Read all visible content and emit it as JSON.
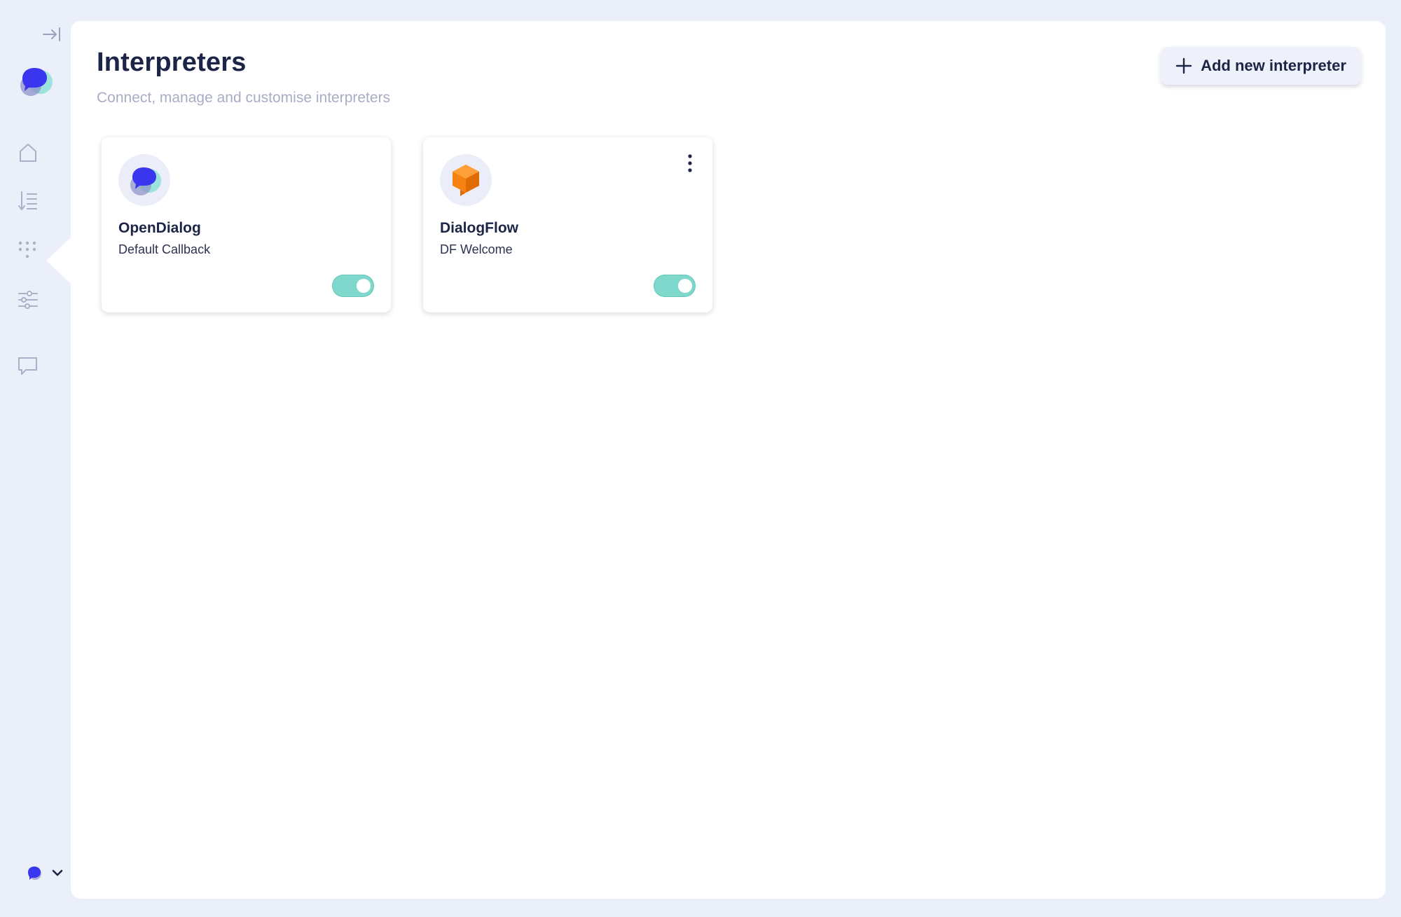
{
  "page": {
    "title": "Interpreters",
    "subtitle": "Connect, manage and customise interpreters"
  },
  "actions": {
    "add_label": "Add new interpreter"
  },
  "interpreters": [
    {
      "name": "OpenDialog",
      "description": "Default Callback",
      "icon": "opendialog-logo-icon",
      "enabled": true,
      "has_menu": false
    },
    {
      "name": "DialogFlow",
      "description": "DF Welcome",
      "icon": "dialogflow-logo-icon",
      "enabled": true,
      "has_menu": true
    }
  ],
  "sidebar": {
    "items": [
      {
        "icon": "home-icon"
      },
      {
        "icon": "ordered-list-icon"
      },
      {
        "icon": "dot-grid-icon",
        "active": true
      },
      {
        "icon": "sliders-icon"
      },
      {
        "icon": "chat-bubble-icon"
      }
    ]
  },
  "colors": {
    "background": "#eaeff9",
    "panel": "#ffffff",
    "title": "#1c2547",
    "subtitle": "#a8adc4",
    "toggle_on": "#7ed8cb",
    "sidebar_icon": "#aab0c8",
    "brand_blue": "#3a36f0",
    "dialogflow_orange": "#f58213"
  }
}
